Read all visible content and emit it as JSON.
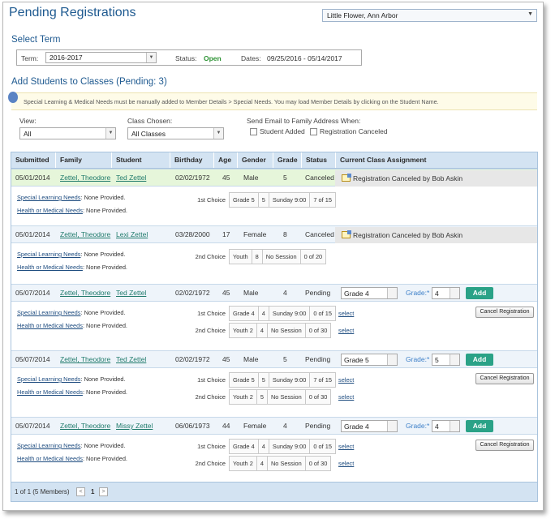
{
  "page_title": "Pending Registrations",
  "location_select": "Little Flower, Ann Arbor",
  "select_term": {
    "title": "Select Term",
    "term_label": "Term:",
    "term_value": "2016-2017",
    "status_label": "Status:",
    "status_value": "Open",
    "dates_label": "Dates:",
    "dates_value": "09/25/2016 - 05/14/2017"
  },
  "add_students_title": "Add Students to Classes (Pending: 3)",
  "notice_text": "Special Learning & Medical Needs must be manually added to Member Details > Special Needs. You may load Member Details by clicking on the Student Name.",
  "filters": {
    "view_label": "View:",
    "view_value": "All",
    "class_label": "Class Chosen:",
    "class_value": "All Classes",
    "email_label": "Send Email to Family Address When:",
    "student_added_label": "Student Added",
    "registration_canceled_label": "Registration Canceled"
  },
  "columns": [
    "Submitted",
    "Family",
    "Student",
    "Birthday",
    "Age",
    "Gender",
    "Grade",
    "Status",
    "Current Class Assignment"
  ],
  "needs": {
    "special_label": "Special Learning Needs",
    "health_label": "Health or Medical Needs",
    "none": ": None Provided."
  },
  "grade_label": "Grade:*",
  "add_label": "Add",
  "select_label": "select",
  "cancel_label": "Cancel Registration",
  "records": [
    {
      "submitted": "05/01/2014",
      "family": "Zettel, Theodore",
      "student": "Ted Zettel",
      "birthday": "02/02/1972",
      "age": "45",
      "gender": "Male",
      "grade": "5",
      "status": "Canceled",
      "assignment": "Registration Canceled by Bob Askin",
      "choices": [
        {
          "label": "1st Choice",
          "cls": "Grade 5",
          "g": "5",
          "session": "Sunday 9:00",
          "count": "7 of 15"
        }
      ]
    },
    {
      "submitted": "05/01/2014",
      "family": "Zettel, Theodore",
      "student": "Lexi Zettel",
      "birthday": "03/28/2000",
      "age": "17",
      "gender": "Female",
      "grade": "8",
      "status": "Canceled",
      "assignment": "Registration Canceled by Bob Askin",
      "choices": [
        {
          "label": "2nd Choice",
          "cls": "Youth",
          "g": "8",
          "session": "No Session",
          "count": "0 of 20"
        }
      ]
    },
    {
      "submitted": "05/07/2014",
      "family": "Zettel, Theodore",
      "student": "Ted Zettel",
      "birthday": "02/02/1972",
      "age": "45",
      "gender": "Male",
      "grade": "4",
      "status": "Pending",
      "class_select": "Grade 4",
      "grade_select": "4",
      "choices": [
        {
          "label": "1st Choice",
          "cls": "Grade 4",
          "g": "4",
          "session": "Sunday 9:00",
          "count": "0 of 15"
        },
        {
          "label": "2nd Choice",
          "cls": "Youth 2",
          "g": "4",
          "session": "No Session",
          "count": "0 of 30"
        }
      ]
    },
    {
      "submitted": "05/07/2014",
      "family": "Zettel, Theodore",
      "student": "Ted Zettel",
      "birthday": "02/02/1972",
      "age": "45",
      "gender": "Male",
      "grade": "5",
      "status": "Pending",
      "class_select": "Grade 5",
      "grade_select": "5",
      "choices": [
        {
          "label": "1st Choice",
          "cls": "Grade 5",
          "g": "5",
          "session": "Sunday 9:00",
          "count": "7 of 15"
        },
        {
          "label": "2nd Choice",
          "cls": "Youth 2",
          "g": "5",
          "session": "No Session",
          "count": "0 of 30"
        }
      ]
    },
    {
      "submitted": "05/07/2014",
      "family": "Zettel, Theodore",
      "student": "Missy Zettel",
      "birthday": "06/06/1973",
      "age": "44",
      "gender": "Female",
      "grade": "4",
      "status": "Pending",
      "class_select": "Grade 4",
      "grade_select": "4",
      "choices": [
        {
          "label": "1st Choice",
          "cls": "Grade 4",
          "g": "4",
          "session": "Sunday 9:00",
          "count": "0 of 15"
        },
        {
          "label": "2nd Choice",
          "cls": "Youth 2",
          "g": "4",
          "session": "No Session",
          "count": "0 of 30"
        }
      ]
    }
  ],
  "pager": {
    "summary": "1 of 1 (5 Members)",
    "page": "1",
    "prev": "<",
    "next": ">"
  }
}
